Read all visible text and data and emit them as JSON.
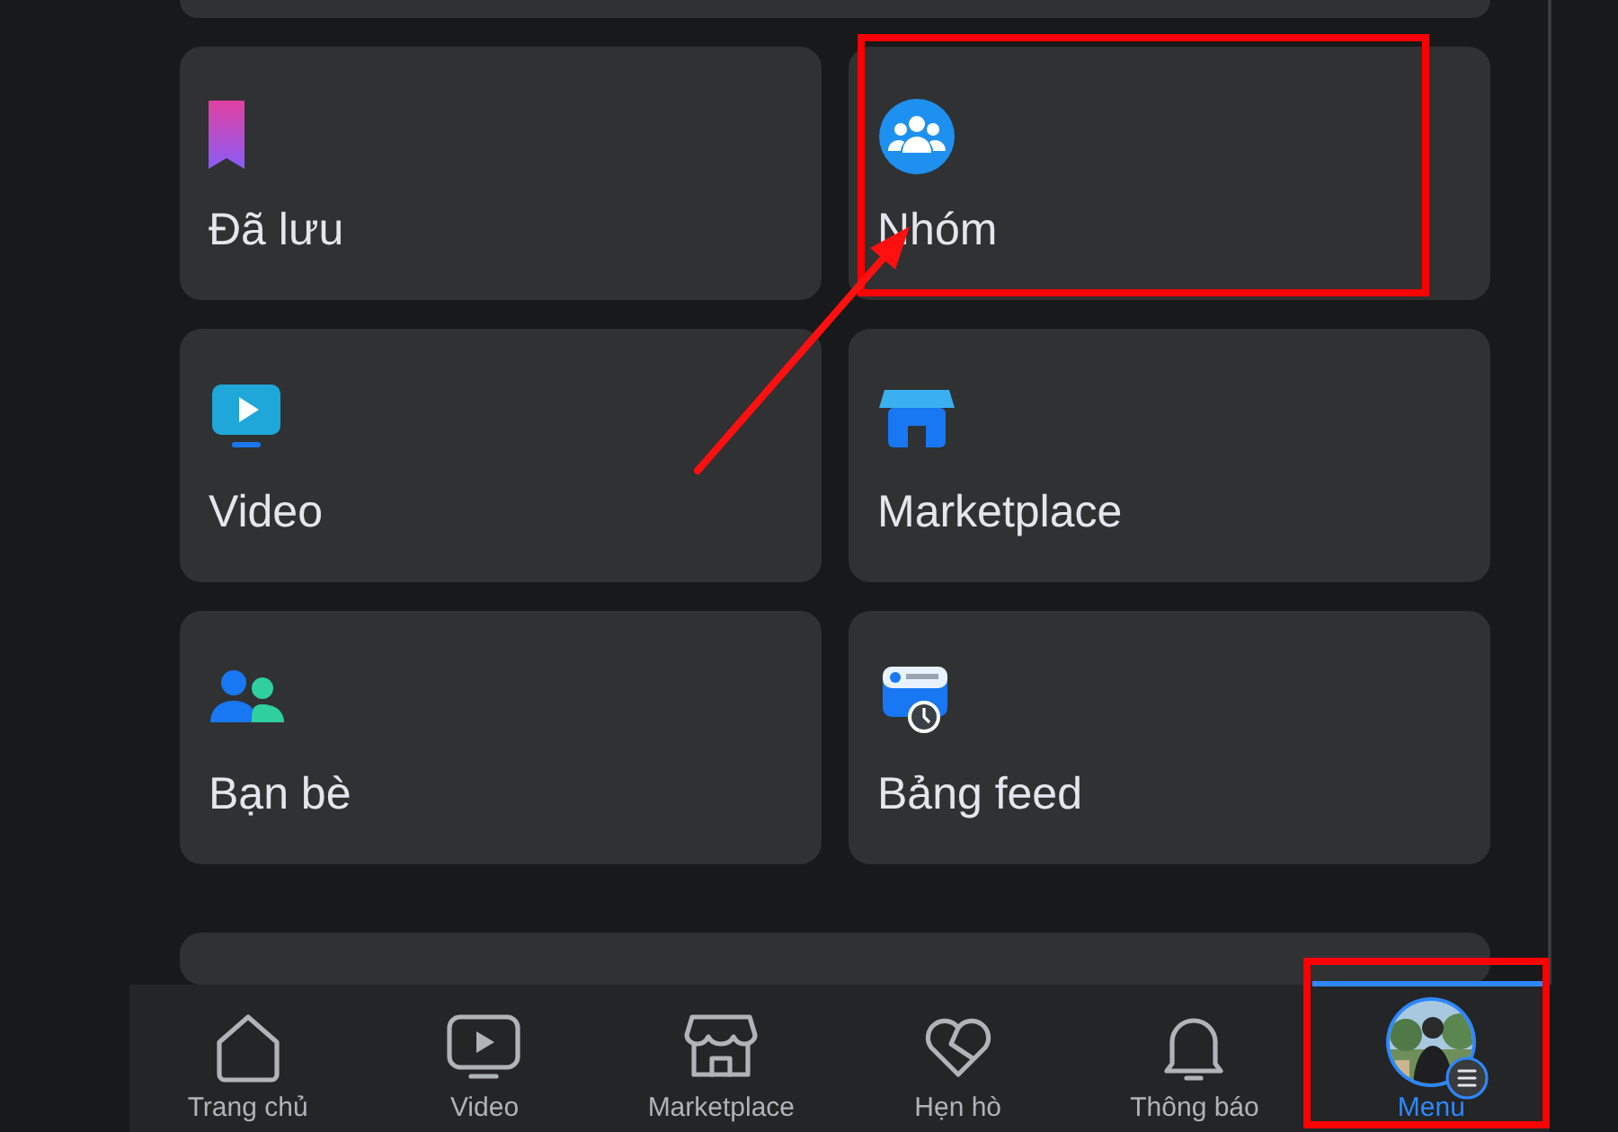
{
  "tiles": [
    {
      "kind": "saved",
      "label": "Đã lưu",
      "highlighted": false
    },
    {
      "kind": "groups",
      "label": "Nhóm",
      "highlighted": true
    },
    {
      "kind": "video",
      "label": "Video",
      "highlighted": false
    },
    {
      "kind": "marketplace",
      "label": "Marketplace",
      "highlighted": false
    },
    {
      "kind": "friends",
      "label": "Bạn bè",
      "highlighted": false
    },
    {
      "kind": "feeds",
      "label": "Bảng feed",
      "highlighted": false
    }
  ],
  "bottom_nav": [
    {
      "kind": "home",
      "label": "Trang chủ",
      "selected": false,
      "highlighted": false
    },
    {
      "kind": "video",
      "label": "Video",
      "selected": false,
      "highlighted": false
    },
    {
      "kind": "marketplace",
      "label": "Marketplace",
      "selected": false,
      "highlighted": false
    },
    {
      "kind": "dating",
      "label": "Hẹn hò",
      "selected": false,
      "highlighted": false
    },
    {
      "kind": "notifications",
      "label": "Thông báo",
      "selected": false,
      "highlighted": false
    },
    {
      "kind": "menu",
      "label": "Menu",
      "selected": true,
      "highlighted": true
    }
  ]
}
